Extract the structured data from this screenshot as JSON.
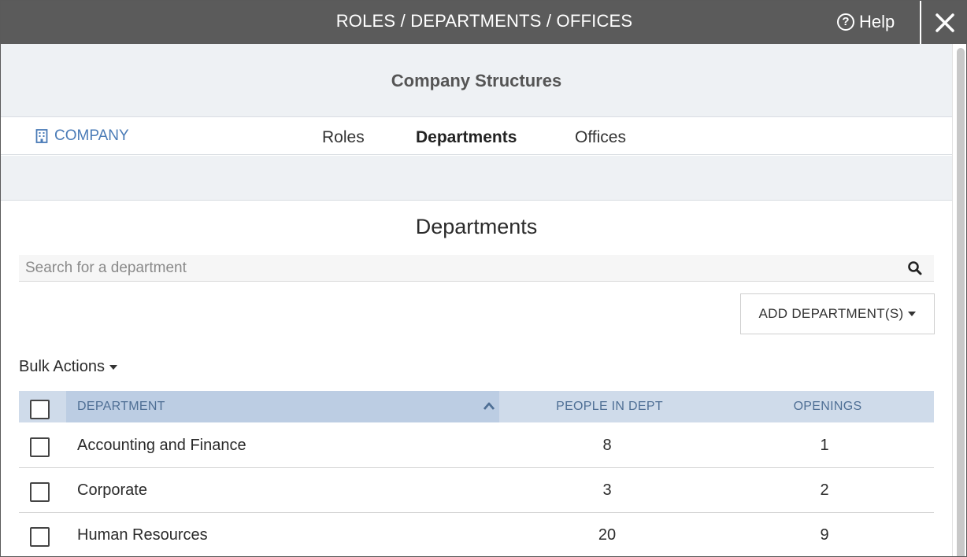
{
  "window": {
    "title": "ROLES / DEPARTMENTS / OFFICES",
    "help_label": "Help"
  },
  "header": {
    "title": "Company Structures"
  },
  "nav": {
    "company_link": "COMPANY",
    "tabs": [
      {
        "label": "Roles",
        "active": false
      },
      {
        "label": "Departments",
        "active": true
      },
      {
        "label": "Offices",
        "active": false
      }
    ]
  },
  "main": {
    "section_title": "Departments",
    "search": {
      "placeholder": "Search for a department",
      "value": ""
    },
    "add_button_label": "ADD DEPARTMENT(S)",
    "bulk_actions_label": "Bulk Actions",
    "table": {
      "columns": [
        "DEPARTMENT",
        "PEOPLE IN DEPT",
        "OPENINGS"
      ],
      "rows": [
        {
          "department": "Accounting and Finance",
          "people": "8",
          "openings": "1"
        },
        {
          "department": "Corporate",
          "people": "3",
          "openings": "2"
        },
        {
          "department": "Human Resources",
          "people": "20",
          "openings": "9"
        }
      ]
    }
  },
  "icons": {
    "help": "help-circle-icon",
    "close": "close-icon",
    "company": "building-icon",
    "search": "search-icon",
    "sort": "chevron-up-icon"
  },
  "colors": {
    "titlebar": "#5b5b5b",
    "accent_link": "#4a7bb7",
    "table_header": "#cfdbea",
    "table_header_sorted": "#bccde3"
  }
}
